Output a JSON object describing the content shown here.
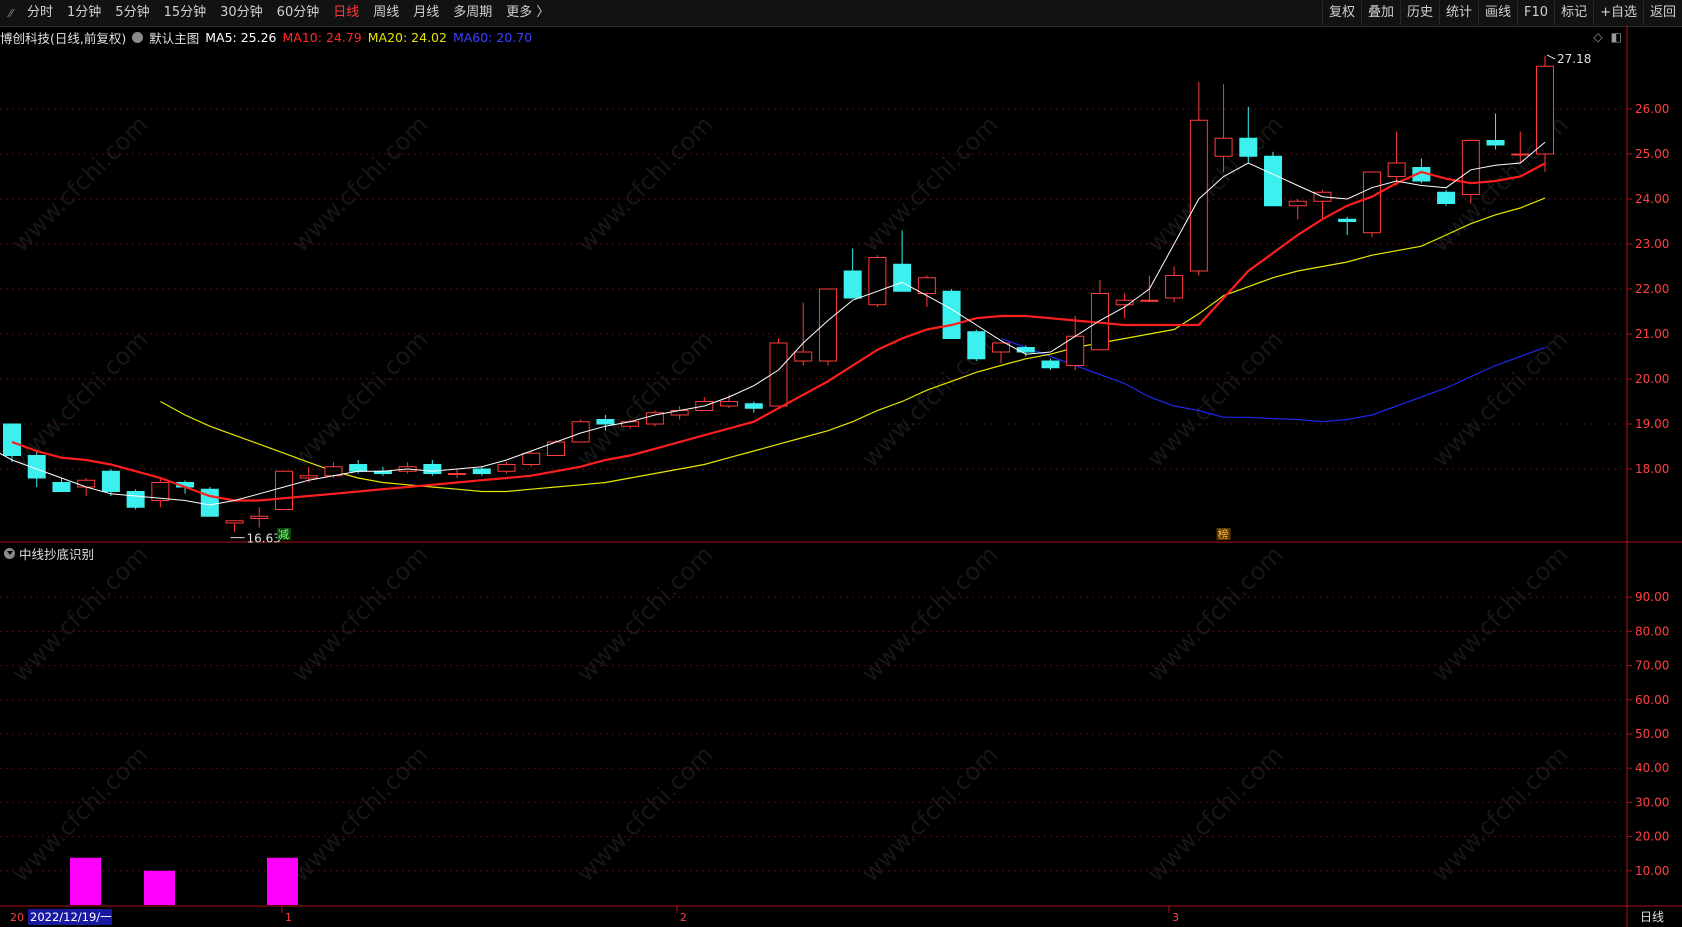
{
  "toolbar": {
    "periods": [
      "分时",
      "1分钟",
      "5分钟",
      "15分钟",
      "30分钟",
      "60分钟",
      "日线",
      "周线",
      "月线",
      "多周期",
      "更多 〉"
    ],
    "active_period": "日线",
    "tools": [
      "复权",
      "叠加",
      "历史",
      "统计",
      "画线",
      "F10",
      "标记",
      "+自选",
      "返回"
    ]
  },
  "info": {
    "stock": "博创科技(日线,前复权)",
    "main_chart": "默认主图",
    "ma5": "MA5: 25.26",
    "ma10": "MA10: 24.79",
    "ma20": "MA20: 24.02",
    "ma60": "MA60: 20.70"
  },
  "colors": {
    "up": "#ff3c3c",
    "down": "#3cf0f0",
    "ma5": "#ffffff",
    "ma10": "#ff1e1e",
    "ma20": "#e6e600",
    "ma60": "#1e28e6",
    "indicator": "#ff00ff",
    "axis_text": "#ff4040"
  },
  "chart_data": [
    {
      "type": "candlestick",
      "y_axis": [
        "26.00",
        "25.00",
        "24.00",
        "23.00",
        "22.00",
        "21.00",
        "20.00",
        "19.00",
        "18.00"
      ],
      "ylim": [
        16.4,
        27.4
      ],
      "high_label": "27.18",
      "low_label": "16.63",
      "markers": [
        "减",
        "榜"
      ],
      "ohlc": [
        [
          19.0,
          19.0,
          18.15,
          18.3
        ],
        [
          18.3,
          18.4,
          17.6,
          17.8
        ],
        [
          17.7,
          17.8,
          17.5,
          17.5
        ],
        [
          17.6,
          17.8,
          17.4,
          17.75
        ],
        [
          17.95,
          18.0,
          17.4,
          17.5
        ],
        [
          17.5,
          17.55,
          17.1,
          17.15
        ],
        [
          17.3,
          17.8,
          17.15,
          17.7
        ],
        [
          17.7,
          17.75,
          17.45,
          17.6
        ],
        [
          17.55,
          17.6,
          16.95,
          16.95
        ],
        [
          16.8,
          16.85,
          16.6,
          16.85
        ],
        [
          16.9,
          17.15,
          16.7,
          16.95
        ],
        [
          17.1,
          17.95,
          17.1,
          17.95
        ],
        [
          17.8,
          18.05,
          17.7,
          17.85
        ],
        [
          17.85,
          18.15,
          17.8,
          18.05
        ],
        [
          18.1,
          18.2,
          17.9,
          17.95
        ],
        [
          17.95,
          18.05,
          17.85,
          17.9
        ],
        [
          17.95,
          18.15,
          17.9,
          18.05
        ],
        [
          18.1,
          18.2,
          17.85,
          17.9
        ],
        [
          17.9,
          18.0,
          17.8,
          17.9
        ],
        [
          18.0,
          18.05,
          17.85,
          17.9
        ],
        [
          17.95,
          18.15,
          17.9,
          18.1
        ],
        [
          18.1,
          18.4,
          18.05,
          18.35
        ],
        [
          18.3,
          18.65,
          18.3,
          18.6
        ],
        [
          18.6,
          19.1,
          18.6,
          19.05
        ],
        [
          19.1,
          19.2,
          18.85,
          19.0
        ],
        [
          18.95,
          19.1,
          18.9,
          19.05
        ],
        [
          19.0,
          19.3,
          18.95,
          19.25
        ],
        [
          19.2,
          19.4,
          19.1,
          19.3
        ],
        [
          19.3,
          19.6,
          19.3,
          19.5
        ],
        [
          19.4,
          19.65,
          19.35,
          19.5
        ],
        [
          19.45,
          19.5,
          19.25,
          19.35
        ],
        [
          19.4,
          20.9,
          19.4,
          20.8
        ],
        [
          20.4,
          21.7,
          20.3,
          20.6
        ],
        [
          20.4,
          22.0,
          20.3,
          22.0
        ],
        [
          22.4,
          22.9,
          21.8,
          21.8
        ],
        [
          21.65,
          22.75,
          21.6,
          22.7
        ],
        [
          22.55,
          23.3,
          22.0,
          21.95
        ],
        [
          21.9,
          22.3,
          21.6,
          22.25
        ],
        [
          21.95,
          22.0,
          20.9,
          20.9
        ],
        [
          21.05,
          21.1,
          20.4,
          20.45
        ],
        [
          20.6,
          20.8,
          20.35,
          20.8
        ],
        [
          20.7,
          20.75,
          20.5,
          20.6
        ],
        [
          20.4,
          20.45,
          20.2,
          20.25
        ],
        [
          20.3,
          21.4,
          20.2,
          20.95
        ],
        [
          20.65,
          22.2,
          20.65,
          21.9
        ],
        [
          21.65,
          21.9,
          21.35,
          21.75
        ],
        [
          21.75,
          22.3,
          21.7,
          21.75
        ],
        [
          21.8,
          22.5,
          21.7,
          22.3
        ],
        [
          22.4,
          26.6,
          22.3,
          25.75
        ],
        [
          24.95,
          26.55,
          24.6,
          25.35
        ],
        [
          25.35,
          26.05,
          24.8,
          24.95
        ],
        [
          24.95,
          25.05,
          23.85,
          23.85
        ],
        [
          23.85,
          24.0,
          23.55,
          23.95
        ],
        [
          23.95,
          24.2,
          23.55,
          24.15
        ],
        [
          23.55,
          23.6,
          23.2,
          23.5
        ],
        [
          23.25,
          24.6,
          23.15,
          24.6
        ],
        [
          24.5,
          25.5,
          24.3,
          24.8
        ],
        [
          24.7,
          24.9,
          24.35,
          24.4
        ],
        [
          24.15,
          24.2,
          23.85,
          23.9
        ],
        [
          24.1,
          25.3,
          23.9,
          25.3
        ],
        [
          25.3,
          25.9,
          25.1,
          25.2
        ],
        [
          25.0,
          25.5,
          24.8,
          25.0
        ],
        [
          25.0,
          27.18,
          24.6,
          26.95
        ]
      ],
      "ma5": [
        18.8,
        18.5,
        18.2,
        18.0,
        17.8,
        17.6,
        17.45,
        17.4,
        17.35,
        17.3,
        17.2,
        17.3,
        17.45,
        17.6,
        17.75,
        17.85,
        17.95,
        17.95,
        18.0,
        17.95,
        18.0,
        18.05,
        18.2,
        18.4,
        18.6,
        18.8,
        18.95,
        19.05,
        19.2,
        19.3,
        19.4,
        19.6,
        19.85,
        20.2,
        20.8,
        21.3,
        21.75,
        21.95,
        22.15,
        21.85,
        21.55,
        21.2,
        20.85,
        20.55,
        20.6,
        20.95,
        21.3,
        21.6,
        22.0,
        23.0,
        24.0,
        24.5,
        24.8,
        24.55,
        24.3,
        24.05,
        24.0,
        24.25,
        24.4,
        24.3,
        24.25,
        24.65,
        24.75,
        24.8,
        25.26
      ],
      "ma10": [
        18.6,
        18.4,
        18.25,
        18.2,
        18.1,
        17.95,
        17.8,
        17.6,
        17.4,
        17.3,
        17.3,
        17.35,
        17.4,
        17.45,
        17.5,
        17.55,
        17.6,
        17.65,
        17.7,
        17.75,
        17.8,
        17.85,
        17.95,
        18.05,
        18.2,
        18.3,
        18.45,
        18.6,
        18.75,
        18.9,
        19.05,
        19.35,
        19.65,
        19.95,
        20.3,
        20.65,
        20.9,
        21.1,
        21.2,
        21.35,
        21.4,
        21.4,
        21.35,
        21.3,
        21.25,
        21.2,
        21.2,
        21.2,
        21.2,
        21.8,
        22.4,
        22.8,
        23.2,
        23.55,
        23.85,
        24.05,
        24.35,
        24.6,
        24.45,
        24.35,
        24.4,
        24.5,
        24.79
      ],
      "ma20": [
        19.5,
        19.2,
        18.95,
        18.75,
        18.55,
        18.35,
        18.15,
        17.95,
        17.8,
        17.7,
        17.65,
        17.6,
        17.55,
        17.5,
        17.5,
        17.55,
        17.6,
        17.65,
        17.7,
        17.8,
        17.9,
        18.0,
        18.1,
        18.25,
        18.4,
        18.55,
        18.7,
        18.85,
        19.05,
        19.3,
        19.5,
        19.75,
        19.95,
        20.15,
        20.3,
        20.45,
        20.55,
        20.7,
        20.8,
        20.9,
        21.0,
        21.1,
        21.45,
        21.85,
        22.05,
        22.25,
        22.4,
        22.5,
        22.6,
        22.75,
        22.85,
        22.95,
        23.2,
        23.45,
        23.65,
        23.8,
        24.02
      ],
      "ma60": [
        20.9,
        20.7,
        20.5,
        20.3,
        20.1,
        19.9,
        19.6,
        19.4,
        19.3,
        19.15,
        19.15,
        19.12,
        19.1,
        19.05,
        19.1,
        19.2,
        19.4,
        19.6,
        19.8,
        20.05,
        20.3,
        20.5,
        20.7
      ]
    },
    {
      "type": "bar",
      "title": "中线抄底识别",
      "y_axis": [
        "90.00",
        "80.00",
        "70.00",
        "60.00",
        "50.00",
        "40.00",
        "30.00",
        "20.00",
        "10.00"
      ],
      "ylim": [
        0,
        100
      ],
      "values": [
        13.8,
        10.0,
        13.8
      ]
    }
  ],
  "x_axis": {
    "date_label": "2022/12/19/一",
    "month_labels": [
      "1",
      "2",
      "3"
    ],
    "period_label": "日线",
    "left_label": "20"
  }
}
